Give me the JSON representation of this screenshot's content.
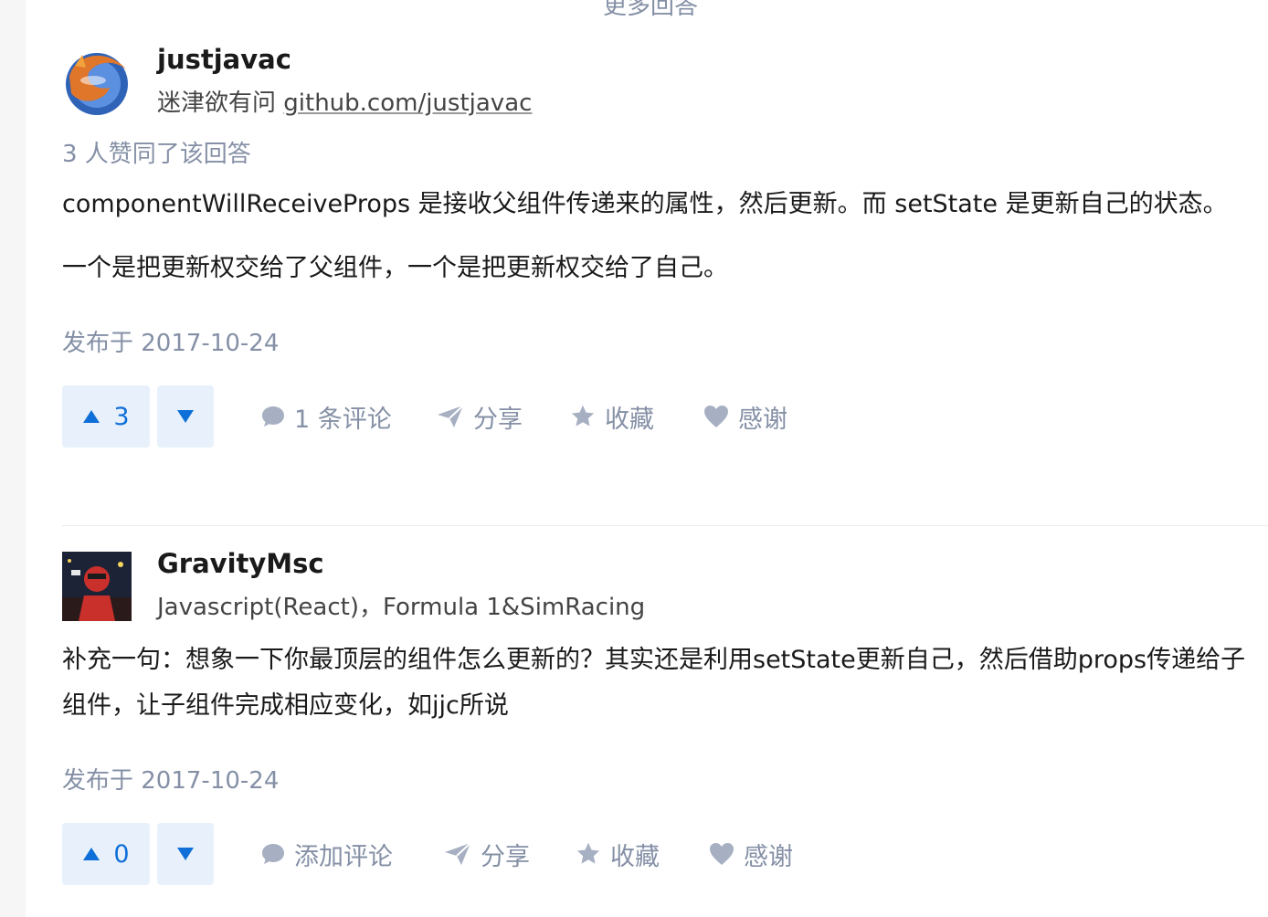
{
  "header": {
    "more_answers": "更多回答"
  },
  "answers": [
    {
      "author": {
        "name": "justjavac",
        "bio_text": "迷津欲有问 ",
        "bio_link": "github.com/justjavac"
      },
      "votes_summary": "3 人赞同了该回答",
      "paragraphs": [
        "componentWillReceiveProps 是接收父组件传递来的属性，然后更新。而 setState 是更新自己的状态。",
        "一个是把更新权交给了父组件，一个是把更新权交给了自己。"
      ],
      "publish_date": "发布于 2017-10-24",
      "vote_count": "3",
      "actions": {
        "comment": "1 条评论",
        "share": "分享",
        "favorite": "收藏",
        "thanks": "感谢"
      }
    },
    {
      "author": {
        "name": "GravityMsc",
        "bio_text": "Javascript(React)，Formula 1&SimRacing"
      },
      "paragraphs": [
        "补充一句：想象一下你最顶层的组件怎么更新的？其实还是利用setState更新自己，然后借助props传递给子组件，让子组件完成相应变化，如jjc所说"
      ],
      "publish_date": "发布于 2017-10-24",
      "vote_count": "0",
      "actions": {
        "comment": "添加评论",
        "share": "分享",
        "favorite": "收藏",
        "thanks": "感谢"
      }
    }
  ],
  "colors": {
    "vote_bg": "#e8f1fb",
    "vote_fg": "#0f6fd8",
    "meta_gray": "#8590a6"
  }
}
